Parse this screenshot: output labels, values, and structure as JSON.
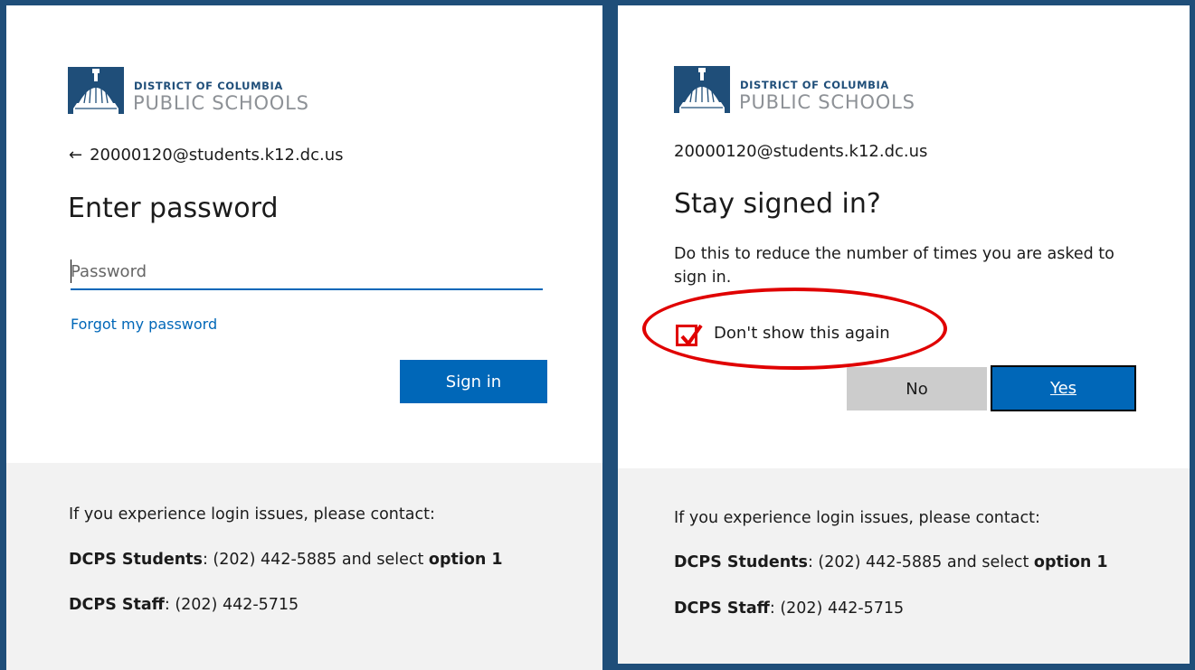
{
  "logo": {
    "line1": "DISTRICT OF COLUMBIA",
    "line2": "PUBLIC SCHOOLS"
  },
  "left_panel": {
    "back_arrow": "←",
    "identity": "20000120@students.k12.dc.us",
    "title": "Enter password",
    "password_placeholder": "Password",
    "forgot_link": "Forgot my password",
    "signin_label": "Sign in"
  },
  "right_panel": {
    "identity": "20000120@students.k12.dc.us",
    "title": "Stay signed in?",
    "description": "Do this to reduce the number of times you are asked to sign in.",
    "checkbox_label": "Don't show this again",
    "checkbox_checked": true,
    "no_label": "No",
    "yes_label": "Yes"
  },
  "footer": {
    "contact_intro": "If you experience login issues, please contact:",
    "students_label": "DCPS Students",
    "students_text_a": ": (202) 442-5885 and select ",
    "students_option": "option 1",
    "staff_label": "DCPS Staff",
    "staff_text": ": (202) 442-5715"
  },
  "colors": {
    "frame": "#1f4e79",
    "accent": "#0067b8",
    "annotation_red": "#e00000",
    "footer_bg": "#f2f2f2"
  }
}
